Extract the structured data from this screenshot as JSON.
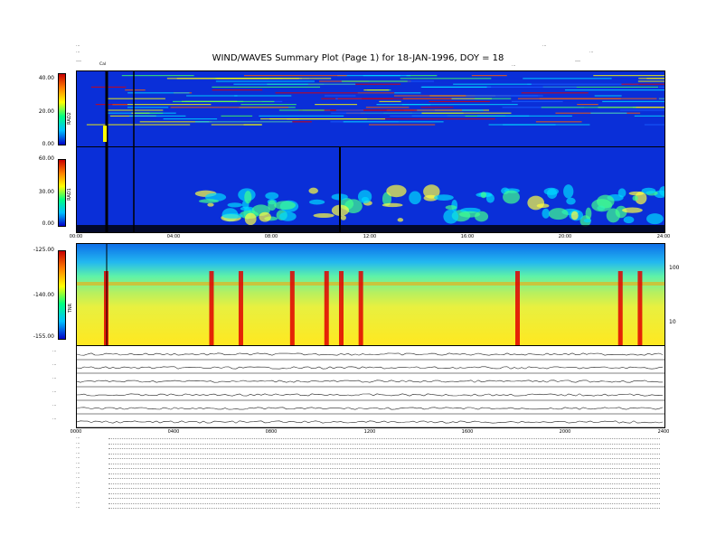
{
  "header": {
    "title": "WIND/WAVES Summary Plot (Page 1) for 18-JAN-1996, DOY = 18",
    "left_line1": "…",
    "left_line2": "…",
    "left_line3": "…",
    "right_line1": "…",
    "right_line2": "…",
    "right_line3": "…",
    "cal_label": "Cal",
    "top_axis_unit": "…"
  },
  "colors": {
    "background_field": "#0a2fd8",
    "spectrum_low": "#0018c8",
    "spectrum_high": "#e00000"
  },
  "chart_data": [
    {
      "type": "heatmap",
      "panel": "RAD2",
      "ylabel": "RAD2",
      "yticks": [
        "40.00",
        "20.00",
        "0.00"
      ],
      "ylim": [
        0,
        40
      ]
    },
    {
      "type": "heatmap",
      "panel": "RAD1",
      "ylabel": "RAD1",
      "yticks": [
        "60.00",
        "30.00",
        "0.00"
      ],
      "ylim": [
        0,
        60
      ],
      "xticks": [
        "00:00",
        "04:00",
        "08:00",
        "12:00",
        "16:00",
        "20:00",
        "24:00"
      ]
    },
    {
      "type": "heatmap",
      "panel": "TNR",
      "ylabel": "TNR",
      "yticks": [
        "-125.00",
        "-140.00",
        "-155.00"
      ],
      "ylim": [
        -155,
        -125
      ],
      "right_ticks": [
        "100",
        "10"
      ],
      "burst_hours": [
        1.2,
        5.5,
        6.7,
        8.8,
        10.2,
        10.8,
        11.6,
        18.0,
        22.2,
        23.0
      ]
    },
    {
      "type": "line",
      "panel": "aux-traces",
      "rows": [
        "…",
        "…",
        "…",
        "…",
        "…",
        "…"
      ],
      "xticks": [
        "0000",
        "0400",
        "0800",
        "1200",
        "1600",
        "2000",
        "2400"
      ]
    }
  ],
  "footer": {
    "lines": [
      "…",
      "…",
      "…",
      "…",
      "…",
      "…",
      "…",
      "…",
      "…",
      "…",
      "…",
      "…",
      "…",
      "…",
      "…"
    ]
  }
}
